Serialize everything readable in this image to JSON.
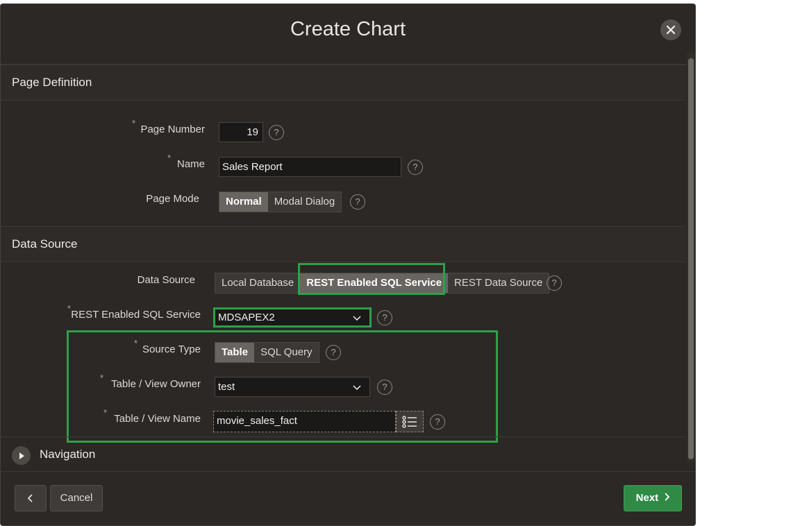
{
  "dialog": {
    "title": "Create Chart",
    "close_icon": "close-icon"
  },
  "page_definition": {
    "title": "Page Definition",
    "page_number_label": "Page Number",
    "page_number_value": "19",
    "name_label": "Name",
    "name_value": "Sales Report",
    "page_mode_label": "Page Mode",
    "page_mode_options": [
      "Normal",
      "Modal Dialog"
    ],
    "page_mode_selected": "Normal"
  },
  "data_source": {
    "title": "Data Source",
    "data_source_label": "Data Source",
    "data_source_options": [
      "Local Database",
      "REST Enabled SQL Service",
      "REST Data Source"
    ],
    "data_source_selected": "REST Enabled SQL Service",
    "rest_service_label": "REST Enabled SQL Service",
    "rest_service_value": "MDSAPEX2",
    "source_type_label": "Source Type",
    "source_type_options": [
      "Table",
      "SQL Query"
    ],
    "source_type_selected": "Table",
    "owner_label": "Table / View Owner",
    "owner_value": "test",
    "view_name_label": "Table / View Name",
    "view_name_value": "movie_sales_fact"
  },
  "navigation": {
    "title": "Navigation"
  },
  "footer": {
    "back_icon": "chevron-left-icon",
    "cancel_label": "Cancel",
    "next_label": "Next"
  },
  "colors": {
    "background": "#2b2825",
    "accent_green": "#2ea04a",
    "next_button": "#2f8a45"
  },
  "misc": {
    "help_glyph": "?",
    "required_glyph": "*"
  }
}
